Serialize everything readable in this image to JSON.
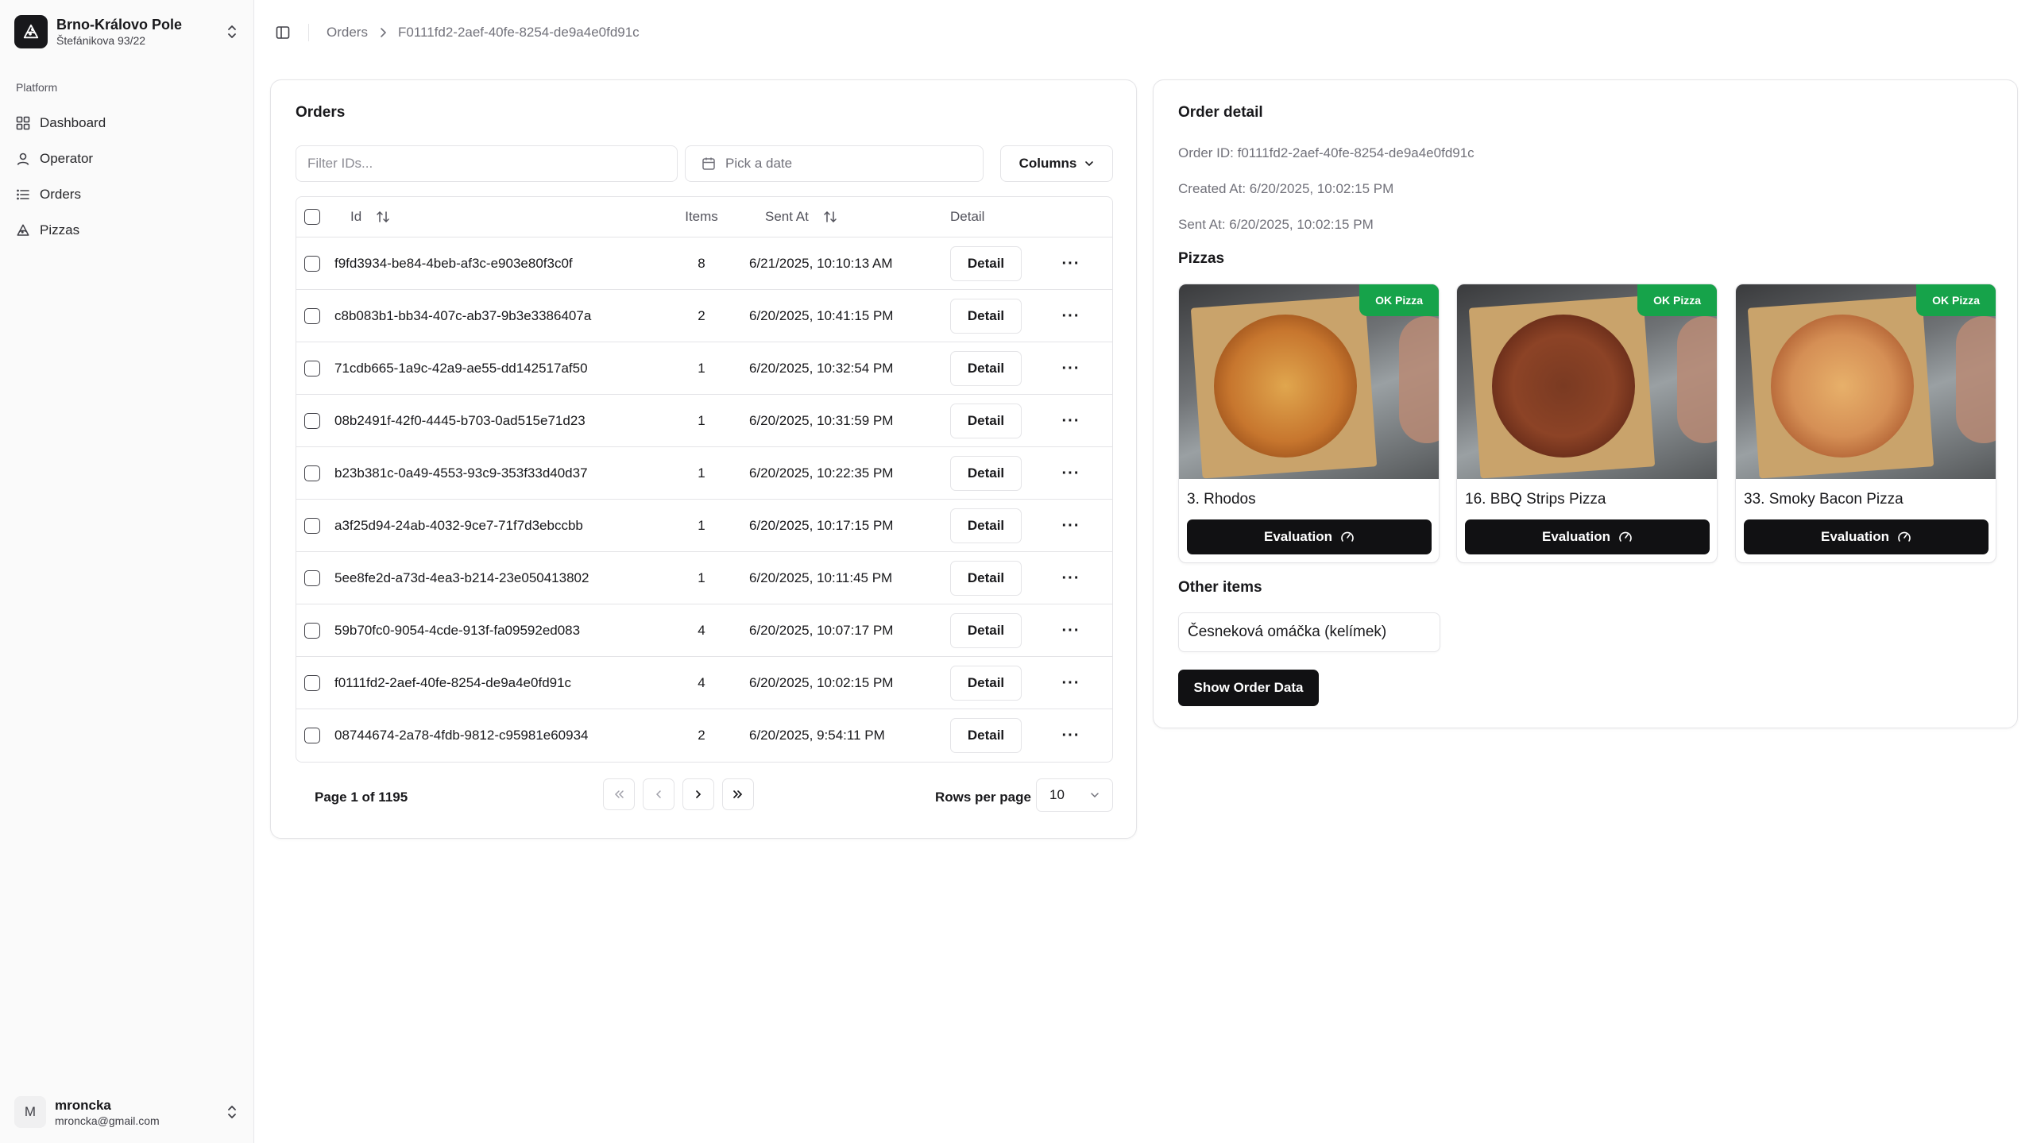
{
  "sidebar": {
    "org_name": "Brno-Královo Pole",
    "org_address": "Štefánikova 93/22",
    "group_label": "Platform",
    "items": [
      {
        "label": "Dashboard",
        "icon": "layout-grid-icon"
      },
      {
        "label": "Operator",
        "icon": "user-icon"
      },
      {
        "label": "Orders",
        "icon": "list-icon"
      },
      {
        "label": "Pizzas",
        "icon": "pizza-icon"
      }
    ],
    "user": {
      "initial": "M",
      "name": "mroncka",
      "email": "mroncka@gmail.com"
    }
  },
  "breadcrumb": {
    "items": [
      "Orders",
      "F0111fd2-2aef-40fe-8254-de9a4e0fd91c"
    ]
  },
  "orders": {
    "title": "Orders",
    "filter_placeholder": "Filter IDs...",
    "date_placeholder": "Pick a date",
    "columns_label": "Columns",
    "headers": {
      "id": "Id",
      "items": "Items",
      "sent_at": "Sent At",
      "detail": "Detail"
    },
    "detail_label": "Detail",
    "more_label": "···",
    "rows": [
      {
        "id": "f9fd3934-be84-4beb-af3c-e903e80f3c0f",
        "items": "8",
        "sent_at": "6/21/2025, 10:10:13 AM"
      },
      {
        "id": "c8b083b1-bb34-407c-ab37-9b3e3386407a",
        "items": "2",
        "sent_at": "6/20/2025, 10:41:15 PM"
      },
      {
        "id": "71cdb665-1a9c-42a9-ae55-dd142517af50",
        "items": "1",
        "sent_at": "6/20/2025, 10:32:54 PM"
      },
      {
        "id": "08b2491f-42f0-4445-b703-0ad515e71d23",
        "items": "1",
        "sent_at": "6/20/2025, 10:31:59 PM"
      },
      {
        "id": "b23b381c-0a49-4553-93c9-353f33d40d37",
        "items": "1",
        "sent_at": "6/20/2025, 10:22:35 PM"
      },
      {
        "id": "a3f25d94-24ab-4032-9ce7-71f7d3ebccbb",
        "items": "1",
        "sent_at": "6/20/2025, 10:17:15 PM"
      },
      {
        "id": "5ee8fe2d-a73d-4ea3-b214-23e050413802",
        "items": "1",
        "sent_at": "6/20/2025, 10:11:45 PM"
      },
      {
        "id": "59b70fc0-9054-4cde-913f-fa09592ed083",
        "items": "4",
        "sent_at": "6/20/2025, 10:07:17 PM"
      },
      {
        "id": "f0111fd2-2aef-40fe-8254-de9a4e0fd91c",
        "items": "4",
        "sent_at": "6/20/2025, 10:02:15 PM"
      },
      {
        "id": "08744674-2a78-4fdb-9812-c95981e60934",
        "items": "2",
        "sent_at": "6/20/2025, 9:54:11 PM"
      }
    ],
    "page_info": "Page 1 of 1195",
    "rows_per_page_label": "Rows per page",
    "rows_per_page_value": "10"
  },
  "detail": {
    "title": "Order detail",
    "order_id": "Order ID: f0111fd2-2aef-40fe-8254-de9a4e0fd91c",
    "created_at": "Created At: 6/20/2025, 10:02:15 PM",
    "sent_at": "Sent At: 6/20/2025, 10:02:15 PM",
    "pizzas_title": "Pizzas",
    "pizzas": [
      {
        "name": "3. Rhodos",
        "badge": "OK Pizza",
        "button": "Evaluation"
      },
      {
        "name": "16. BBQ Strips Pizza",
        "badge": "OK Pizza",
        "button": "Evaluation"
      },
      {
        "name": "33. Smoky Bacon Pizza",
        "badge": "OK Pizza",
        "button": "Evaluation"
      }
    ],
    "other_title": "Other items",
    "other_items": [
      "Česneková omáčka (kelímek)"
    ],
    "show_button": "Show Order Data"
  },
  "colors": {
    "ok_badge": "#16a34a",
    "primary_button": "#111113"
  }
}
